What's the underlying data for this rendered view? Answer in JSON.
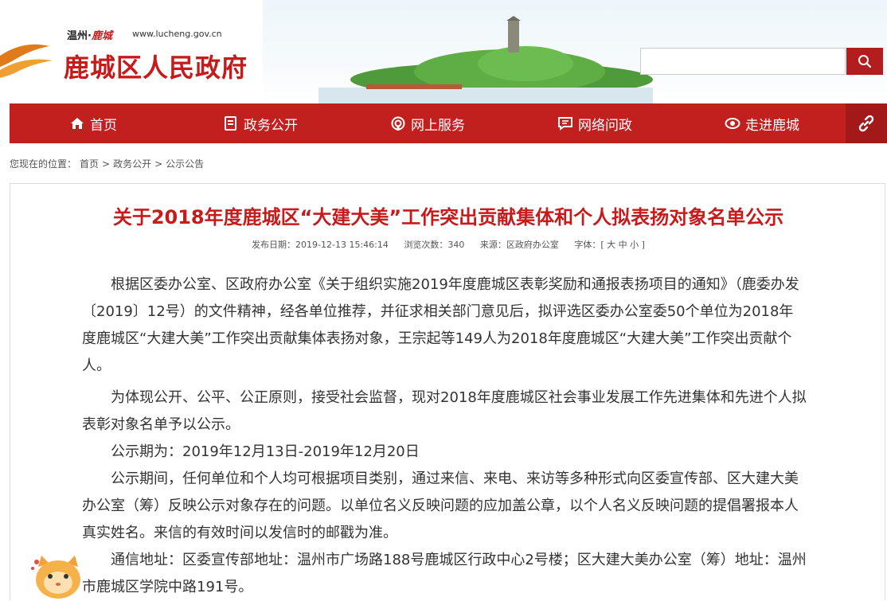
{
  "header": {
    "site_small": "温州·",
    "site_small_accent": "鹿城",
    "site_url": "www.lucheng.gov.cn",
    "site_title": "鹿城区人民政府",
    "search_placeholder": ""
  },
  "nav": {
    "items": [
      {
        "label": "首页",
        "icon": "home-icon"
      },
      {
        "label": "政务公开",
        "icon": "document-icon"
      },
      {
        "label": "网上服务",
        "icon": "service-icon"
      },
      {
        "label": "网络问政",
        "icon": "chat-icon"
      },
      {
        "label": "走进鹿城",
        "icon": "eye-icon"
      }
    ],
    "link_icon": "link-icon"
  },
  "breadcrumb": {
    "prefix": "您现在的位置：",
    "items": [
      "首页",
      "政务公开",
      "公示公告"
    ],
    "sep": ">"
  },
  "article": {
    "title": "关于2018年度鹿城区“大建大美”工作突出贡献集体和个人拟表扬对象名单公示",
    "meta": {
      "date": "发布日期：2019-12-13 15:46:14",
      "views": "浏览次数：340",
      "source": "来源：区政府办公室",
      "font": "字体：[ 大 中 小 ]"
    },
    "paragraphs": [
      "根据区委办公室、区政府办公室《关于组织实施2019年度鹿城区表彰奖励和通报表扬项目的通知》（鹿委办发〔2019〕12号）的文件精神，经各单位推荐，并征求相关部门意见后，拟评选区委办公室委50个单位为2018年度鹿城区“大建大美”工作突出贡献集体表扬对象，王宗起等149人为2018年度鹿城区“大建大美”工作突出贡献个人。",
      "为体现公开、公平、公正原则，接受社会监督，现对2018年度鹿城区社会事业发展工作先进集体和先进个人拟表彰对象名单予以公示。",
      "公示期为：2019年12月13日-2019年12月20日",
      "公示期间，任何单位和个人均可根据项目类别，通过来信、来电、来访等多种形式向区委宣传部、区大建大美办公室（筹）反映公示对象存在的问题。以单位名义反映问题的应加盖公章，以个人名义反映问题的提倡署报本人真实姓名。来信的有效时间以发信时的邮戳为准。",
      "通信地址：区委宣传部地址：温州市广场路188号鹿城区行政中心2号楼；区大建大美办公室（筹）地址：温州市鹿城区学院中路191号。"
    ]
  },
  "colors": {
    "brand_red": "#c21f1f",
    "title_red": "#c71b1b"
  }
}
